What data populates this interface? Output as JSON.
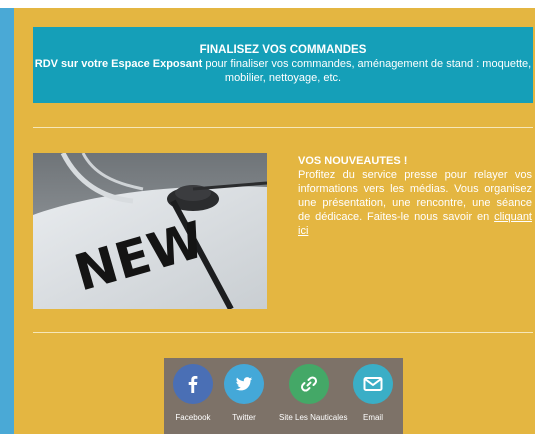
{
  "banner": {
    "title": "FINALISEZ VOS COMMANDES",
    "lead_bold": "RDV sur votre Espace Exposant",
    "text": " pour finaliser vos commandes, aménagement de stand : moquette, mobilier, nettoyage, etc."
  },
  "news": {
    "title": "VOS NOUVEAUTES !",
    "body": "Profitez du service presse pour relayer vos informations vers les médias. Vous organisez une présentation, une rencontre, une séance de dédicace. Faites-le nous savoir en ",
    "link": "cliquant ici",
    "image_text": "NEW"
  },
  "social": [
    {
      "label": "Facebook",
      "icon": "facebook-icon",
      "color": "#4a6fb5"
    },
    {
      "label": "Twitter",
      "icon": "twitter-icon",
      "color": "#44a8d8"
    },
    {
      "label": "Site Les Nauticales",
      "icon": "link-icon",
      "color": "#44a867"
    },
    {
      "label": "Email",
      "icon": "email-icon",
      "color": "#3aaec6"
    }
  ],
  "colors": {
    "background": "#e4b641",
    "banner": "#159fb8",
    "left_bar": "#4aa9d6",
    "social_bar": "#7d7268"
  }
}
